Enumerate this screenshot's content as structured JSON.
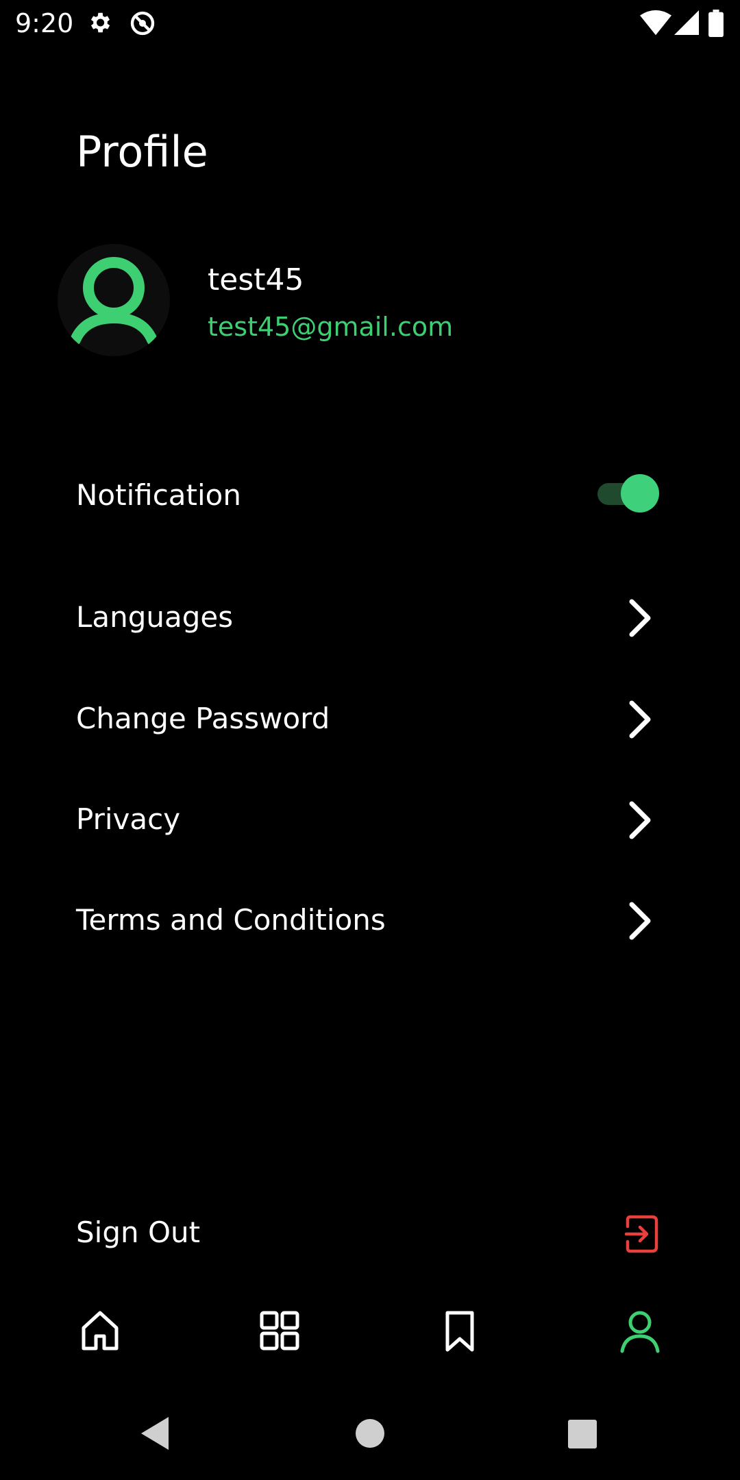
{
  "status_bar": {
    "time": "9:20",
    "icons": [
      "settings-icon",
      "do-not-disturb-icon",
      "wifi-icon",
      "cell-signal-icon",
      "battery-icon"
    ]
  },
  "header": {
    "title": "Profile"
  },
  "profile": {
    "avatar_icon": "user-icon",
    "username": "test45",
    "email": "test45@gmail.com"
  },
  "settings": {
    "notification": {
      "label": "Notification",
      "enabled": true
    },
    "items": [
      {
        "label": "Languages",
        "icon": "chevron-right-icon"
      },
      {
        "label": "Change Password",
        "icon": "chevron-right-icon"
      },
      {
        "label": "Privacy",
        "icon": "chevron-right-icon"
      },
      {
        "label": "Terms and Conditions",
        "icon": "chevron-right-icon"
      }
    ],
    "sign_out": {
      "label": "Sign Out",
      "icon": "logout-icon"
    }
  },
  "bottom_nav": {
    "items": [
      {
        "icon": "home-icon",
        "active": false
      },
      {
        "icon": "grid-icon",
        "active": false
      },
      {
        "icon": "bookmark-icon",
        "active": false
      },
      {
        "icon": "profile-icon",
        "active": true
      }
    ]
  },
  "colors": {
    "accent": "#3ecf72",
    "danger": "#e8413d",
    "background": "#000000",
    "text": "#ffffff"
  }
}
